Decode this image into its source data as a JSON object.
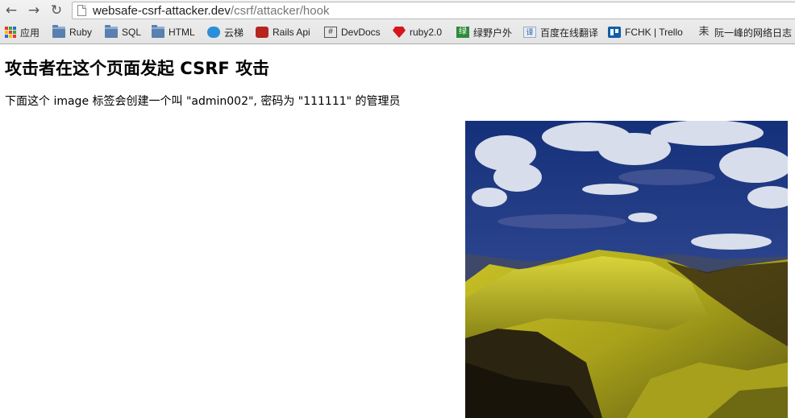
{
  "browser": {
    "back_icon": "back-arrow-icon",
    "forward_icon": "forward-arrow-icon",
    "reload_icon": "reload-icon",
    "url_host": "websafe-csrf-attacker.dev",
    "url_path": "/csrf/attacker/hook"
  },
  "bookmarks": [
    {
      "label": "应用",
      "icon": "apps-grid-icon"
    },
    {
      "label": "Ruby",
      "icon": "folder-icon"
    },
    {
      "label": "SQL",
      "icon": "folder-icon"
    },
    {
      "label": "HTML",
      "icon": "folder-icon"
    },
    {
      "label": "云梯",
      "icon": "cloud-icon"
    },
    {
      "label": "Rails Api",
      "icon": "rails-icon"
    },
    {
      "label": "DevDocs",
      "icon": "devdocs-icon"
    },
    {
      "label": "ruby2.0",
      "icon": "ruby-gem-icon"
    },
    {
      "label": "绿野户外",
      "icon": "lvye-icon"
    },
    {
      "label": "百度在线翻译",
      "icon": "baidu-translate-icon"
    },
    {
      "label": "FCHK | Trello",
      "icon": "trello-icon"
    },
    {
      "label": "阮一峰的网络日志",
      "icon": "blog-icon"
    }
  ],
  "page": {
    "heading": "攻击者在这个页面发起 CSRF 攻击",
    "description": "下面这个 image 标签会创建一个叫 \"admin002\", 密码为 \"111111\" 的管理员",
    "image_icon": "mountain-landscape-image"
  },
  "colors": {
    "sky": "#2b3d86",
    "grass": "#b9b21c",
    "shadow": "#2b2410"
  }
}
